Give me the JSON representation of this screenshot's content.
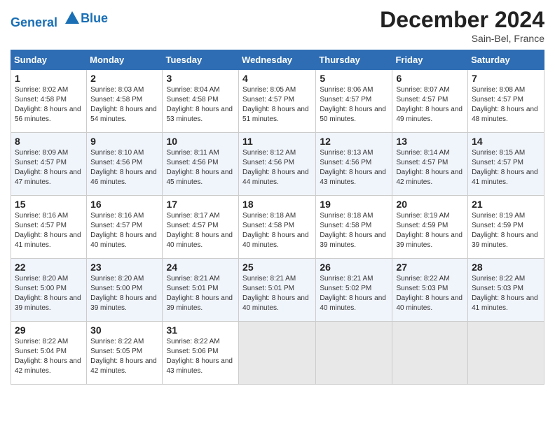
{
  "header": {
    "logo_line1": "General",
    "logo_line2": "Blue",
    "month_year": "December 2024",
    "location": "Sain-Bel, France"
  },
  "days_of_week": [
    "Sunday",
    "Monday",
    "Tuesday",
    "Wednesday",
    "Thursday",
    "Friday",
    "Saturday"
  ],
  "weeks": [
    [
      {
        "day": "1",
        "sunrise": "8:02 AM",
        "sunset": "4:58 PM",
        "daylight": "8 hours and 56 minutes."
      },
      {
        "day": "2",
        "sunrise": "8:03 AM",
        "sunset": "4:58 PM",
        "daylight": "8 hours and 54 minutes."
      },
      {
        "day": "3",
        "sunrise": "8:04 AM",
        "sunset": "4:58 PM",
        "daylight": "8 hours and 53 minutes."
      },
      {
        "day": "4",
        "sunrise": "8:05 AM",
        "sunset": "4:57 PM",
        "daylight": "8 hours and 51 minutes."
      },
      {
        "day": "5",
        "sunrise": "8:06 AM",
        "sunset": "4:57 PM",
        "daylight": "8 hours and 50 minutes."
      },
      {
        "day": "6",
        "sunrise": "8:07 AM",
        "sunset": "4:57 PM",
        "daylight": "8 hours and 49 minutes."
      },
      {
        "day": "7",
        "sunrise": "8:08 AM",
        "sunset": "4:57 PM",
        "daylight": "8 hours and 48 minutes."
      }
    ],
    [
      {
        "day": "8",
        "sunrise": "8:09 AM",
        "sunset": "4:57 PM",
        "daylight": "8 hours and 47 minutes."
      },
      {
        "day": "9",
        "sunrise": "8:10 AM",
        "sunset": "4:56 PM",
        "daylight": "8 hours and 46 minutes."
      },
      {
        "day": "10",
        "sunrise": "8:11 AM",
        "sunset": "4:56 PM",
        "daylight": "8 hours and 45 minutes."
      },
      {
        "day": "11",
        "sunrise": "8:12 AM",
        "sunset": "4:56 PM",
        "daylight": "8 hours and 44 minutes."
      },
      {
        "day": "12",
        "sunrise": "8:13 AM",
        "sunset": "4:56 PM",
        "daylight": "8 hours and 43 minutes."
      },
      {
        "day": "13",
        "sunrise": "8:14 AM",
        "sunset": "4:57 PM",
        "daylight": "8 hours and 42 minutes."
      },
      {
        "day": "14",
        "sunrise": "8:15 AM",
        "sunset": "4:57 PM",
        "daylight": "8 hours and 41 minutes."
      }
    ],
    [
      {
        "day": "15",
        "sunrise": "8:16 AM",
        "sunset": "4:57 PM",
        "daylight": "8 hours and 41 minutes."
      },
      {
        "day": "16",
        "sunrise": "8:16 AM",
        "sunset": "4:57 PM",
        "daylight": "8 hours and 40 minutes."
      },
      {
        "day": "17",
        "sunrise": "8:17 AM",
        "sunset": "4:57 PM",
        "daylight": "8 hours and 40 minutes."
      },
      {
        "day": "18",
        "sunrise": "8:18 AM",
        "sunset": "4:58 PM",
        "daylight": "8 hours and 40 minutes."
      },
      {
        "day": "19",
        "sunrise": "8:18 AM",
        "sunset": "4:58 PM",
        "daylight": "8 hours and 39 minutes."
      },
      {
        "day": "20",
        "sunrise": "8:19 AM",
        "sunset": "4:59 PM",
        "daylight": "8 hours and 39 minutes."
      },
      {
        "day": "21",
        "sunrise": "8:19 AM",
        "sunset": "4:59 PM",
        "daylight": "8 hours and 39 minutes."
      }
    ],
    [
      {
        "day": "22",
        "sunrise": "8:20 AM",
        "sunset": "5:00 PM",
        "daylight": "8 hours and 39 minutes."
      },
      {
        "day": "23",
        "sunrise": "8:20 AM",
        "sunset": "5:00 PM",
        "daylight": "8 hours and 39 minutes."
      },
      {
        "day": "24",
        "sunrise": "8:21 AM",
        "sunset": "5:01 PM",
        "daylight": "8 hours and 39 minutes."
      },
      {
        "day": "25",
        "sunrise": "8:21 AM",
        "sunset": "5:01 PM",
        "daylight": "8 hours and 40 minutes."
      },
      {
        "day": "26",
        "sunrise": "8:21 AM",
        "sunset": "5:02 PM",
        "daylight": "8 hours and 40 minutes."
      },
      {
        "day": "27",
        "sunrise": "8:22 AM",
        "sunset": "5:03 PM",
        "daylight": "8 hours and 40 minutes."
      },
      {
        "day": "28",
        "sunrise": "8:22 AM",
        "sunset": "5:03 PM",
        "daylight": "8 hours and 41 minutes."
      }
    ],
    [
      {
        "day": "29",
        "sunrise": "8:22 AM",
        "sunset": "5:04 PM",
        "daylight": "8 hours and 42 minutes."
      },
      {
        "day": "30",
        "sunrise": "8:22 AM",
        "sunset": "5:05 PM",
        "daylight": "8 hours and 42 minutes."
      },
      {
        "day": "31",
        "sunrise": "8:22 AM",
        "sunset": "5:06 PM",
        "daylight": "8 hours and 43 minutes."
      },
      null,
      null,
      null,
      null
    ]
  ]
}
